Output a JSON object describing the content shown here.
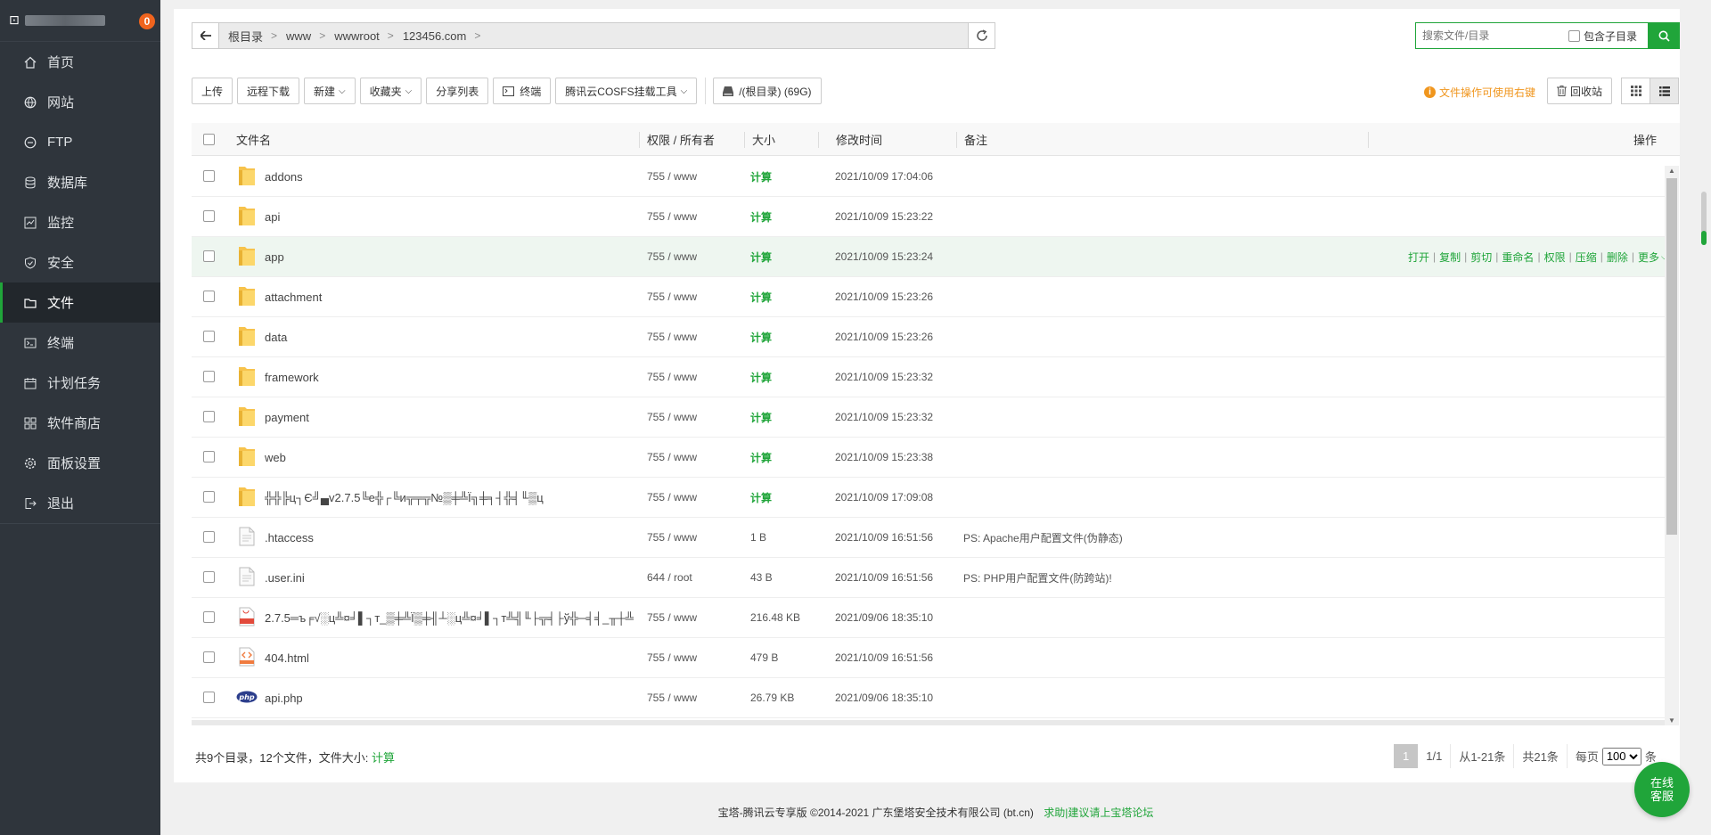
{
  "sidebar": {
    "logo": "⊡",
    "badge": "0",
    "items": [
      {
        "label": "首页",
        "icon": "home-icon"
      },
      {
        "label": "网站",
        "icon": "globe-icon"
      },
      {
        "label": "FTP",
        "icon": "ftp-icon"
      },
      {
        "label": "数据库",
        "icon": "database-icon"
      },
      {
        "label": "监控",
        "icon": "monitor-icon"
      },
      {
        "label": "安全",
        "icon": "shield-icon"
      },
      {
        "label": "文件",
        "icon": "folder-icon",
        "active": true
      },
      {
        "label": "终端",
        "icon": "terminal-icon"
      },
      {
        "label": "计划任务",
        "icon": "calendar-icon"
      },
      {
        "label": "软件商店",
        "icon": "apps-icon"
      },
      {
        "label": "面板设置",
        "icon": "gear-icon"
      },
      {
        "label": "退出",
        "icon": "logout-icon"
      }
    ]
  },
  "path": {
    "back_icon": "arrow-left-icon",
    "crumbs": [
      "根目录",
      "www",
      "wwwroot",
      "123456.com"
    ],
    "refresh_icon": "refresh-icon"
  },
  "search": {
    "placeholder": "搜索文件/目录",
    "include_sub_label": "包含子目录"
  },
  "toolbar": {
    "upload": "上传",
    "remote_download": "远程下载",
    "new": "新建",
    "favorites": "收藏夹",
    "share_list": "分享列表",
    "terminal": "终端",
    "cosfs": "腾讯云COSFS挂载工具",
    "disk": "/(根目录) (69G)"
  },
  "hint": "文件操作可使用右键",
  "recycle": "回收站",
  "table": {
    "headers": {
      "name": "文件名",
      "perm": "权限 / 所有者",
      "size": "大小",
      "mtime": "修改时间",
      "note": "备注",
      "ops": "操作"
    },
    "rows": [
      {
        "name": "addons",
        "type": "folder",
        "perm": "755 / www",
        "size": "计算",
        "mtime": "2021/10/09 17:04:06",
        "note": ""
      },
      {
        "name": "api",
        "type": "folder",
        "perm": "755 / www",
        "size": "计算",
        "mtime": "2021/10/09 15:23:22",
        "note": ""
      },
      {
        "name": "app",
        "type": "folder",
        "perm": "755 / www",
        "size": "计算",
        "mtime": "2021/10/09 15:23:24",
        "note": "",
        "hover": true
      },
      {
        "name": "attachment",
        "type": "folder",
        "perm": "755 / www",
        "size": "计算",
        "mtime": "2021/10/09 15:23:26",
        "note": ""
      },
      {
        "name": "data",
        "type": "folder",
        "perm": "755 / www",
        "size": "计算",
        "mtime": "2021/10/09 15:23:26",
        "note": ""
      },
      {
        "name": "framework",
        "type": "folder",
        "perm": "755 / www",
        "size": "计算",
        "mtime": "2021/10/09 15:23:32",
        "note": ""
      },
      {
        "name": "payment",
        "type": "folder",
        "perm": "755 / www",
        "size": "计算",
        "mtime": "2021/10/09 15:23:32",
        "note": ""
      },
      {
        "name": "web",
        "type": "folder",
        "perm": "755 / www",
        "size": "计算",
        "mtime": "2021/10/09 15:23:38",
        "note": ""
      },
      {
        "name": "╬╬╠ц┐Є╝▄v2.7.5╚е╬┌╚и╦╤╦№▒╪╩Ї╗╪╕┤╬╡╙▒ц",
        "type": "folder",
        "perm": "755 / www",
        "size": "计算",
        "mtime": "2021/10/09 17:09:08",
        "note": ""
      },
      {
        "name": ".htaccess",
        "type": "file",
        "perm": "755 / www",
        "size": "1 B",
        "mtime": "2021/10/09 16:51:56",
        "note": "PS: Apache用户配置文件(伪静态)"
      },
      {
        "name": ".user.ini",
        "type": "file",
        "perm": "644 / root",
        "size": "43 B",
        "mtime": "2021/10/09 16:51:56",
        "note": "PS: PHP用户配置文件(防跨站)!"
      },
      {
        "name": "2.7.5═ъ╒√░ц╩¤╛▌┐т_▒╪╩Ї▒╪╢┴░ц╩¤╛▌┐т╩╣╙├╦╡├ў╬─╡╡_╥┼╩╔╬я▒╪╩Ї...",
        "type": "sql",
        "perm": "755 / www",
        "size": "216.48 KB",
        "mtime": "2021/09/06 18:35:10",
        "note": ""
      },
      {
        "name": "404.html",
        "type": "html",
        "perm": "755 / www",
        "size": "479 B",
        "mtime": "2021/10/09 16:51:56",
        "note": ""
      },
      {
        "name": "api.php",
        "type": "php",
        "perm": "755 / www",
        "size": "26.79 KB",
        "mtime": "2021/09/06 18:35:10",
        "note": ""
      }
    ],
    "row_ops": [
      "打开",
      "复制",
      "剪切",
      "重命名",
      "权限",
      "压缩",
      "删除",
      "更多"
    ]
  },
  "summary": {
    "text": "共9个目录，12个文件，文件大小:",
    "calc": "计算"
  },
  "pager": {
    "current": "1",
    "pages": "1/1",
    "range": "从1-21条",
    "total": "共21条",
    "per_page_label": "每页",
    "per_page_value": "100",
    "unit": "条"
  },
  "footer": {
    "copyright": "宝塔-腾讯云专享版 ©2014-2021 广东堡塔安全技术有限公司 (bt.cn)",
    "link": "求助|建议请上宝塔论坛"
  },
  "help_button": "在线客服",
  "colors": {
    "accent": "#20a53a",
    "sidebar": "#2f353c",
    "warning": "#f0961e",
    "badge": "#f0641e"
  }
}
